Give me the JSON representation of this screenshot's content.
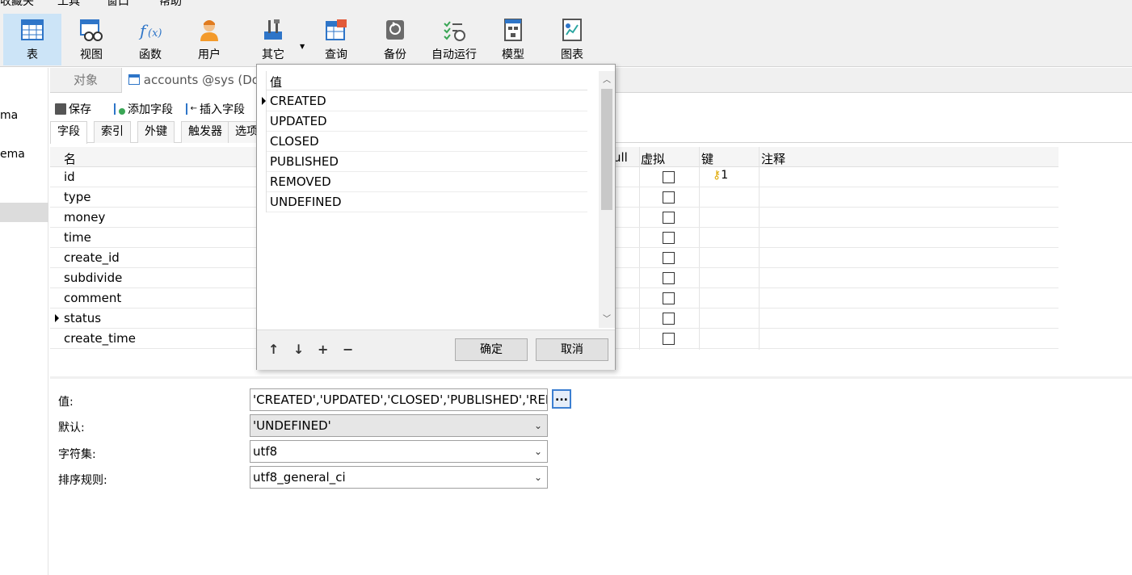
{
  "menubar": {
    "items": [
      "收藏夹",
      "工具",
      "窗口",
      "帮助"
    ]
  },
  "ribbon": {
    "tools": [
      {
        "label": "表",
        "icon": "table-icon"
      },
      {
        "label": "视图",
        "icon": "view-icon"
      },
      {
        "label": "函数",
        "icon": "function-icon"
      },
      {
        "label": "用户",
        "icon": "user-icon"
      },
      {
        "label": "其它",
        "icon": "tools-icon"
      },
      {
        "label": "查询",
        "icon": "query-icon"
      },
      {
        "label": "备份",
        "icon": "backup-icon"
      },
      {
        "label": "自动运行",
        "icon": "schedule-icon"
      },
      {
        "label": "模型",
        "icon": "model-icon"
      },
      {
        "label": "图表",
        "icon": "chart-icon"
      }
    ]
  },
  "sidebar": {
    "items": [
      "ma",
      "ema"
    ]
  },
  "tabs": {
    "objects": "对象",
    "document": "accounts @sys (Doc"
  },
  "actions": {
    "save": "保存",
    "add_field": "添加字段",
    "insert_field": "插入字段"
  },
  "subtabs": [
    "字段",
    "索引",
    "外键",
    "触发器",
    "选项"
  ],
  "grid": {
    "headers": {
      "name": "名",
      "null": "ull",
      "virtual": "虚拟",
      "key": "键",
      "comment": "注释"
    },
    "rows": [
      {
        "name": "id",
        "key": "1"
      },
      {
        "name": "type",
        "key": ""
      },
      {
        "name": "money",
        "key": ""
      },
      {
        "name": "time",
        "key": ""
      },
      {
        "name": "create_id",
        "key": ""
      },
      {
        "name": "subdivide",
        "key": ""
      },
      {
        "name": "comment",
        "key": ""
      },
      {
        "name": "status",
        "key": ""
      },
      {
        "name": "create_time",
        "key": ""
      }
    ]
  },
  "props": {
    "value_label": "值:",
    "value": "'CREATED','UPDATED','CLOSED','PUBLISHED','REMOVED','UNDEFINED'",
    "ellipsis": "...",
    "default_label": "默认:",
    "default": "'UNDEFINED'",
    "charset_label": "字符集:",
    "charset": "utf8",
    "collation_label": "排序规则:",
    "collation": "utf8_general_ci"
  },
  "popup": {
    "header": "值",
    "values": [
      "CREATED",
      "UPDATED",
      "CLOSED",
      "PUBLISHED",
      "REMOVED",
      "UNDEFINED"
    ],
    "ok": "确定",
    "cancel": "取消",
    "controls": {
      "up": "↑",
      "down": "↓",
      "add": "+",
      "remove": "−"
    }
  }
}
